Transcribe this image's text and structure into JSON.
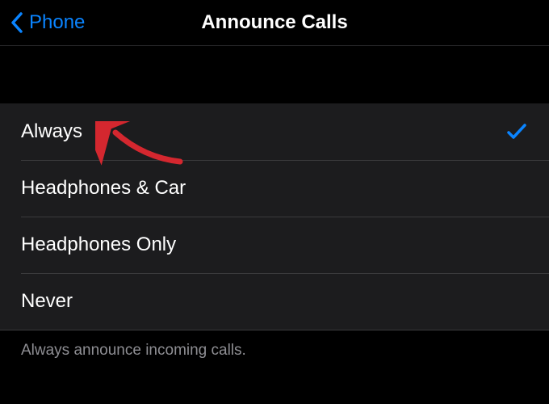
{
  "nav": {
    "back_label": "Phone",
    "title": "Announce Calls"
  },
  "options": [
    {
      "label": "Always",
      "selected": true
    },
    {
      "label": "Headphones & Car",
      "selected": false
    },
    {
      "label": "Headphones Only",
      "selected": false
    },
    {
      "label": "Never",
      "selected": false
    }
  ],
  "footer": {
    "description": "Always announce incoming calls."
  },
  "colors": {
    "accent": "#0a84ff",
    "annotation": "#d4272f"
  }
}
